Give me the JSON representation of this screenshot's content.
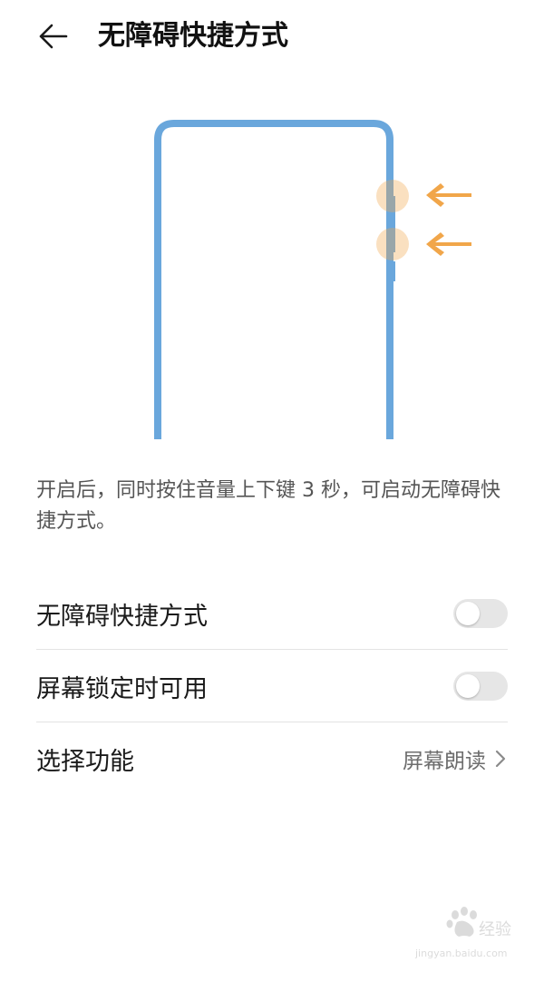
{
  "header": {
    "title": "无障碍快捷方式",
    "back_icon": "arrow-left-icon"
  },
  "illustration": {
    "frame_color": "#6aa7dc",
    "indicator_color": "#f1a64a",
    "icon": "phone-volume-keys-icon"
  },
  "description": "开启后，同时按住音量上下键 3 秒，可启动无障碍快捷方式。",
  "settings": [
    {
      "label": "无障碍快捷方式",
      "type": "toggle",
      "enabled": false
    },
    {
      "label": "屏幕锁定时可用",
      "type": "toggle",
      "enabled": false
    },
    {
      "label": "选择功能",
      "type": "link",
      "value": "屏幕朗读",
      "icon": "chevron-right-icon"
    }
  ],
  "watermark": {
    "text": "Baidu 经验",
    "subtext": "jingyan.baidu.com"
  }
}
